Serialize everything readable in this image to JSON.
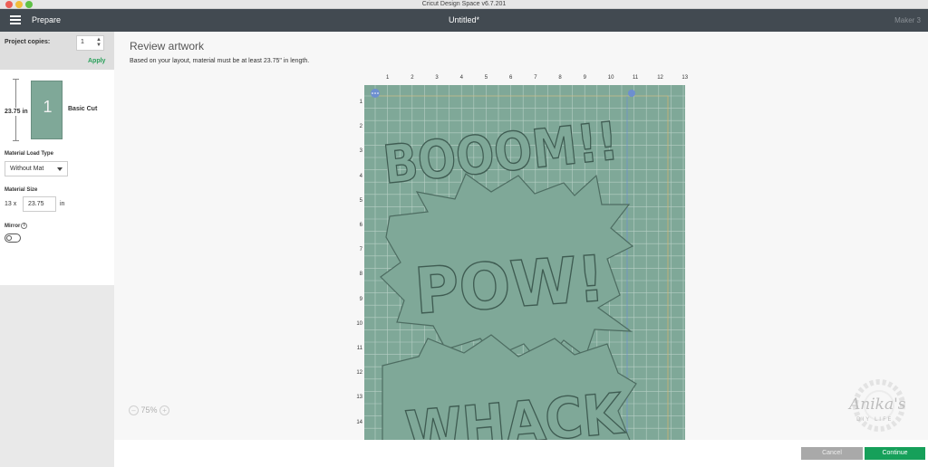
{
  "window": {
    "title": "Cricut Design Space  v6.7.201"
  },
  "header": {
    "mode": "Prepare",
    "document_title": "Untitled*",
    "machine": "Maker 3"
  },
  "left_panel": {
    "copies_label": "Project copies:",
    "copies_value": "1",
    "apply_label": "Apply",
    "mat_length": "23.75 in",
    "mat_number": "1",
    "mat_mode": "Basic Cut",
    "load_type_label": "Material Load Type",
    "load_type_value": "Without Mat",
    "size_label": "Material Size",
    "size_width": "13 x",
    "size_length": "23.75",
    "size_unit": "in",
    "mirror_label": "Mirror",
    "mirror_on": false
  },
  "main": {
    "title": "Review artwork",
    "description": "Based on your layout, material must be at least 23.75\" in length.",
    "ruler_top": [
      "1",
      "2",
      "3",
      "4",
      "5",
      "6",
      "7",
      "8",
      "9",
      "10",
      "11",
      "12",
      "13"
    ],
    "ruler_left": [
      "1",
      "2",
      "3",
      "4",
      "5",
      "6",
      "7",
      "8",
      "9",
      "10",
      "11",
      "12",
      "13",
      "14"
    ],
    "artwork_words": [
      "BOOOM!!",
      "POW!",
      "WHACK"
    ],
    "zoom": "75%",
    "colors": {
      "mat": "#7fa898",
      "accent": "#16a05a",
      "header": "#424a51"
    }
  },
  "footer": {
    "cancel_label": "Cancel",
    "continue_label": "Continue"
  },
  "watermark": {
    "line1": "Anika's",
    "line2": "DIY LIFE"
  }
}
